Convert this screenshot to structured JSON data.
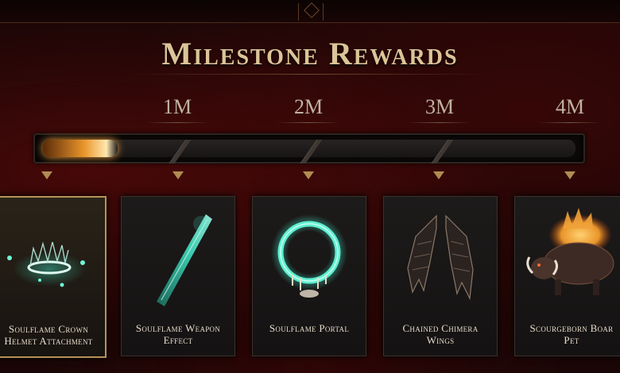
{
  "title": "Milestone Rewards",
  "progress": {
    "fraction": 0.14
  },
  "milestones": [
    {
      "label": ""
    },
    {
      "label": "1M"
    },
    {
      "label": "2M"
    },
    {
      "label": "3M"
    },
    {
      "label": "4M"
    }
  ],
  "rewards": [
    {
      "name": "Soulflame Crown\nHelmet Attachment",
      "icon": "crown-icon",
      "active": true
    },
    {
      "name": "Soulflame Weapon\nEffect",
      "icon": "weapon-effect-icon",
      "active": false
    },
    {
      "name": "Soulflame Portal",
      "icon": "portal-icon",
      "active": false
    },
    {
      "name": "Chained Chimera\nWings",
      "icon": "wings-icon",
      "active": false
    },
    {
      "name": "Scourgeborn Boar\nPet",
      "icon": "boar-pet-icon",
      "active": false
    }
  ],
  "colors": {
    "accent_gold": "#b69358",
    "teal_glow": "#3ee0c0",
    "flame_orange": "#e9952a"
  }
}
